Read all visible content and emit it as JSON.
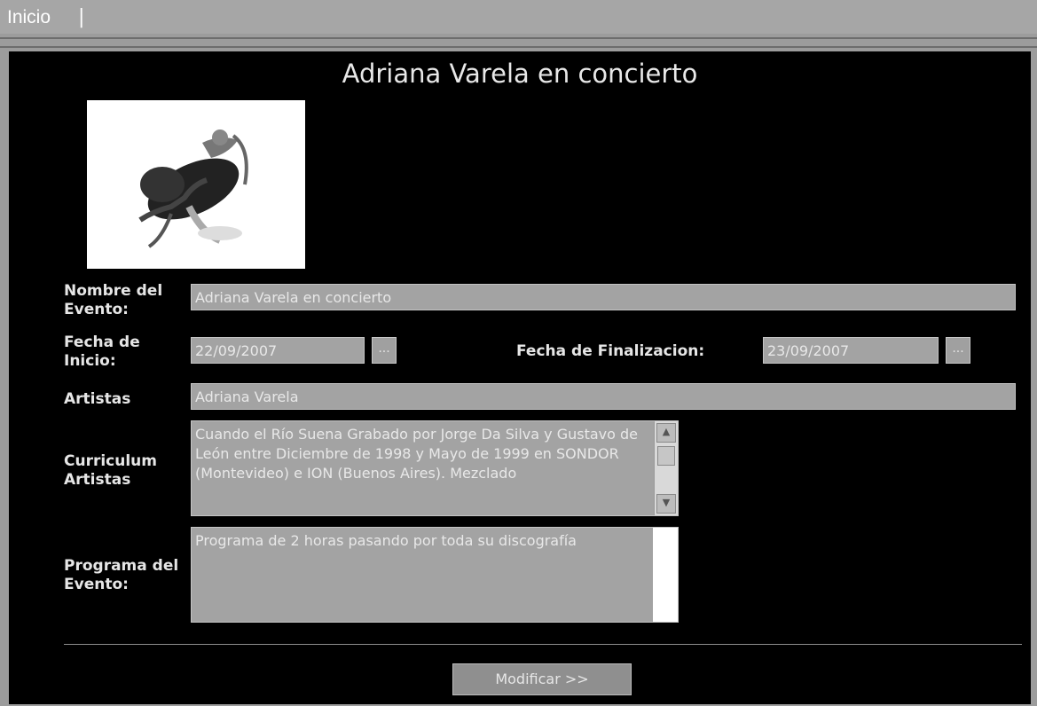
{
  "nav": {
    "home_label": "Inicio",
    "separator": "|"
  },
  "event": {
    "title": "Adriana Varela en concierto",
    "photo_description": "dancer-photo",
    "labels": {
      "name": "Nombre del Evento:",
      "start_date": "Fecha de Inicio:",
      "end_date": "Fecha de Finalizacion:",
      "artists": "Artistas",
      "curriculum": "Curriculum Artistas",
      "program": "Programa del Evento:"
    },
    "values": {
      "name": "Adriana Varela en concierto",
      "start_date": "22/09/2007",
      "end_date": "23/09/2007",
      "artists": "Adriana Varela",
      "curriculum": "Cuando el Río Suena Grabado por Jorge Da Silva y Gustavo de León entre Diciembre de 1998 y Mayo de 1999 en SONDOR (Montevideo) e ION (Buenos Aires). Mezclado",
      "program": "Programa de 2 horas pasando por toda su discografía"
    },
    "date_picker_label": "...",
    "submit_label": "Modificar >>"
  }
}
